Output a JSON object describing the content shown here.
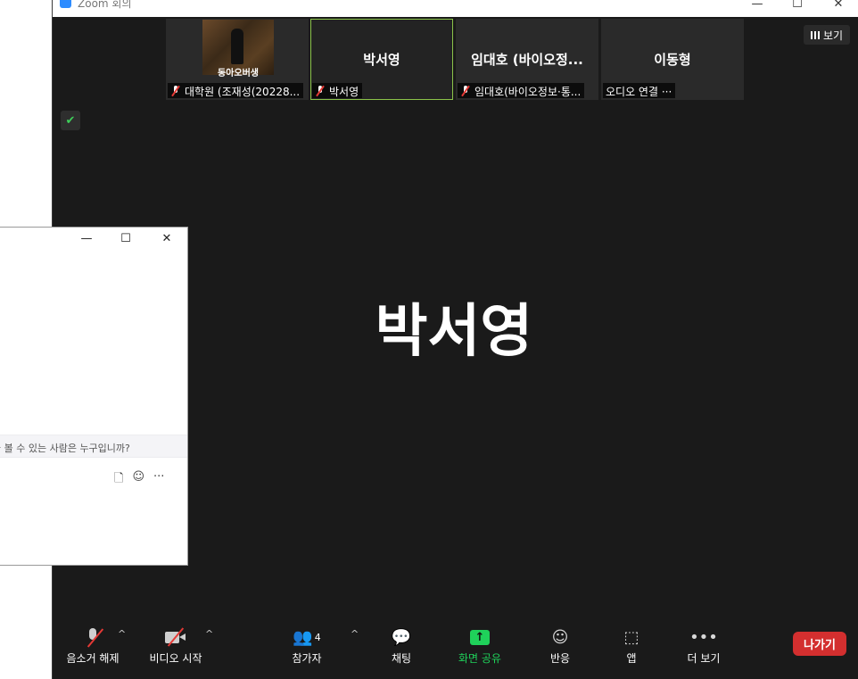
{
  "window": {
    "title": "Zoom 회의",
    "minimize": "—",
    "maximize": "☐",
    "close": "✕"
  },
  "view_button": {
    "label": "보기",
    "icon": "grid-icon"
  },
  "participants": [
    {
      "name": "",
      "caption": "대학원 (조재성(20228...",
      "muted": true,
      "video_caption": "동아오버생"
    },
    {
      "name": "박서영",
      "caption": "박서영",
      "muted": true,
      "active": true
    },
    {
      "name": "임대호 (바이오정...",
      "caption": "임대호(바이오정보·통...",
      "muted": true
    },
    {
      "name": "이동형",
      "caption": "오디오 연결 ···",
      "muted": false
    }
  ],
  "security_badge": {
    "icon": "shield-icon",
    "color": "#3ecf5a"
  },
  "active_speaker": "박서영",
  "toolbar": {
    "unmute": "음소거 해제",
    "start_video": "비디오 시작",
    "participants": "참가자",
    "participants_count": "4",
    "chat": "채팅",
    "share": "화면 공유",
    "reactions": "반응",
    "apps": "앱",
    "more": "더 보기",
    "leave": "나가기",
    "caret": "^",
    "share_color": "#1fd15a",
    "leave_color": "#d32f2f"
  },
  "chat_window": {
    "minimize": "—",
    "maximize": "☐",
    "close": "✕",
    "who_can_see": "을 볼 수 있는 사람은 누구입니까?",
    "file_icon": "file-icon",
    "emoji_icon": "emoji-icon",
    "more": "···"
  }
}
